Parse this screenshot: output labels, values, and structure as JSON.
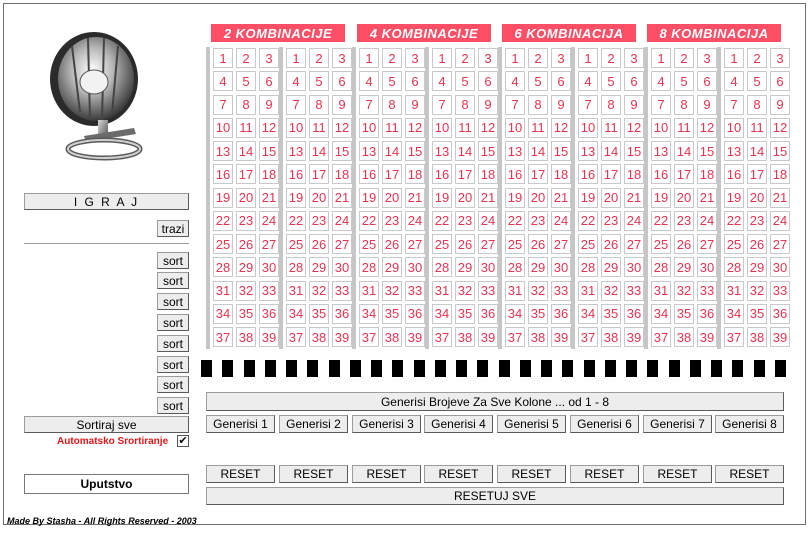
{
  "colors": {
    "accent": "#ff4f66",
    "number_red": "#e53552",
    "auto_label_red": "#e0171b",
    "button_bg": "#ededed"
  },
  "left": {
    "image": "lottery-drum-icon",
    "igraj_label": "I G R A J",
    "trazi_label": "trazi",
    "sort_label": "sort",
    "sortiraj_label": "Sortiraj sve",
    "auto_sort_label": "Automatsko Srortiranje",
    "auto_sort_checked": true,
    "uputstvo_label": "Uputstvo"
  },
  "headers": [
    "2 KOMBINACIJE",
    "4 KOMBINACIJE",
    "6 KOMBINACIJA",
    "8 KOMBINACIJA"
  ],
  "numbers": [
    1,
    2,
    3,
    4,
    5,
    6,
    7,
    8,
    9,
    10,
    11,
    12,
    13,
    14,
    15,
    16,
    17,
    18,
    19,
    20,
    21,
    22,
    23,
    24,
    25,
    26,
    27,
    28,
    29,
    30,
    31,
    32,
    33,
    34,
    35,
    36,
    37,
    38,
    39
  ],
  "generate_all_label": "Generisi Brojeve Za Sve Kolone ... od 1 - 8",
  "generate_buttons": [
    "Generisi 1",
    "Generisi 2",
    "Generisi 3",
    "Generisi 4",
    "Generisi 5",
    "Generisi 6",
    "Generisi 7",
    "Generisi 8"
  ],
  "reset_label": "RESET",
  "reset_all_label": "RESETUJ SVE",
  "footer": "Made By Stasha - All Rights Reserved - 2003"
}
